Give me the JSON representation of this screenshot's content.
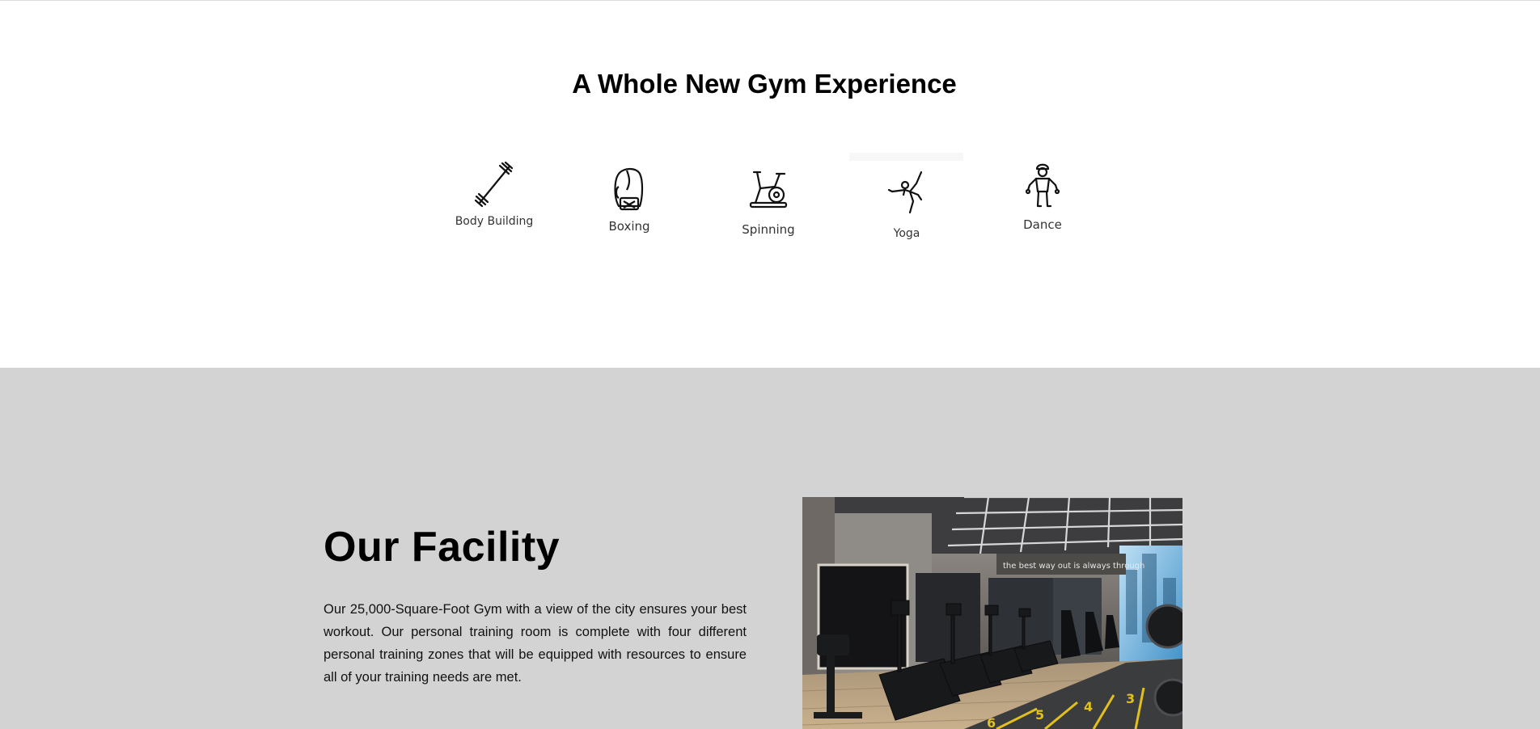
{
  "experience": {
    "title": "A Whole New Gym Experience",
    "activities": [
      {
        "label": "Body Building",
        "icon": "barbell-icon"
      },
      {
        "label": "Boxing",
        "icon": "boxing-glove-icon"
      },
      {
        "label": "Spinning",
        "icon": "exercise-bike-icon"
      },
      {
        "label": "Yoga",
        "icon": "yoga-pose-icon"
      },
      {
        "label": "Dance",
        "icon": "dancer-icon"
      }
    ]
  },
  "facility": {
    "title": "Our Facility",
    "description": "Our 25,000-Square-Foot Gym with a view of the city ensures your best workout. Our personal training room is complete with four different personal training zones that will be equipped with resources to ensure all of your training needs are met.",
    "photo_wall_text": "the best way out is always through",
    "photo_lane_numbers": [
      "6",
      "5",
      "4",
      "3"
    ]
  },
  "colors": {
    "top_background": "#ffffff",
    "facility_background": "#d3d3d3",
    "heading": "#000000",
    "label": "#333333"
  }
}
